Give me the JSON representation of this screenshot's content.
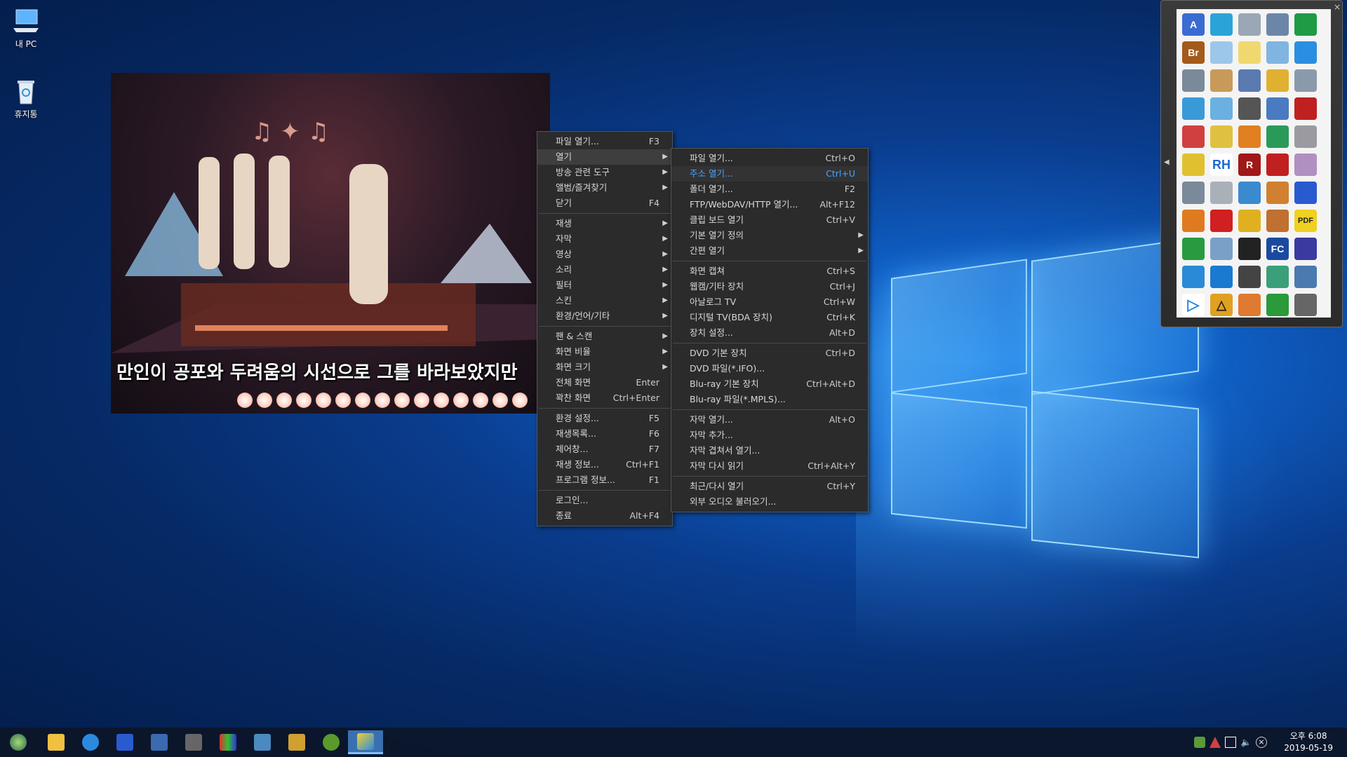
{
  "desktop": {
    "icons": [
      {
        "label": "내 PC",
        "icon": "computer-icon"
      },
      {
        "label": "휴지통",
        "icon": "recycle-bin-icon"
      }
    ]
  },
  "video": {
    "subtitle": "만인이 공포와 두려움의 시선으로 그를 바라보았지만"
  },
  "main_menu": {
    "items": [
      {
        "label": "파일 열기...",
        "shortcut": "F3"
      },
      {
        "label": "열기",
        "submenu": true,
        "highlighted": true
      },
      {
        "label": "방송 관련 도구",
        "submenu": true
      },
      {
        "label": "앨범/즐겨찾기",
        "submenu": true
      },
      {
        "label": "닫기",
        "shortcut": "F4"
      },
      {
        "label": "재생",
        "submenu": true
      },
      {
        "label": "자막",
        "submenu": true
      },
      {
        "label": "영상",
        "submenu": true
      },
      {
        "label": "소리",
        "submenu": true
      },
      {
        "label": "필터",
        "submenu": true
      },
      {
        "label": "스킨",
        "submenu": true
      },
      {
        "label": "환경/언어/기타",
        "submenu": true
      },
      {
        "label": "팬 & 스캔",
        "submenu": true
      },
      {
        "label": "화면 비율",
        "submenu": true
      },
      {
        "label": "화면 크기",
        "submenu": true
      },
      {
        "label": "전체 화면",
        "shortcut": "Enter"
      },
      {
        "label": "꽉찬 화면",
        "shortcut": "Ctrl+Enter"
      },
      {
        "label": "환경 설정...",
        "shortcut": "F5"
      },
      {
        "label": "재생목록...",
        "shortcut": "F6"
      },
      {
        "label": "제어창...",
        "shortcut": "F7"
      },
      {
        "label": "재생 정보...",
        "shortcut": "Ctrl+F1"
      },
      {
        "label": "프로그램 정보...",
        "shortcut": "F1"
      },
      {
        "label": "로그인..."
      },
      {
        "label": "종료",
        "shortcut": "Alt+F4"
      }
    ]
  },
  "open_submenu": {
    "items": [
      {
        "label": "파일 열기...",
        "shortcut": "Ctrl+O"
      },
      {
        "label": "주소 열기...",
        "shortcut": "Ctrl+U",
        "highlighted": true
      },
      {
        "label": "폴더 열기...",
        "shortcut": "F2"
      },
      {
        "label": "FTP/WebDAV/HTTP 열기...",
        "shortcut": "Alt+F12"
      },
      {
        "label": "클립 보드 열기",
        "shortcut": "Ctrl+V"
      },
      {
        "label": "기본 열기 정의",
        "submenu": true
      },
      {
        "label": "간편 열기",
        "submenu": true
      },
      {
        "label": "화면 캡쳐",
        "shortcut": "Ctrl+S"
      },
      {
        "label": "웹캠/기타 장치",
        "shortcut": "Ctrl+J"
      },
      {
        "label": "아날로그 TV",
        "shortcut": "Ctrl+W"
      },
      {
        "label": "디지털 TV(BDA 장치)",
        "shortcut": "Ctrl+K"
      },
      {
        "label": "장치 설정...",
        "shortcut": "Alt+D"
      },
      {
        "label": "DVD 기본 장치",
        "shortcut": "Ctrl+D"
      },
      {
        "label": "DVD 파일(*.IFO)..."
      },
      {
        "label": "Blu-ray 기본 장치",
        "shortcut": "Ctrl+Alt+D"
      },
      {
        "label": "Blu-ray 파일(*.MPLS)..."
      },
      {
        "label": "자막 열기...",
        "shortcut": "Alt+O"
      },
      {
        "label": "자막 추가..."
      },
      {
        "label": "자막 겹쳐서 열기..."
      },
      {
        "label": "자막 다시 읽기",
        "shortcut": "Ctrl+Alt+Y"
      },
      {
        "label": "최근/다시 열기",
        "shortcut": "Ctrl+Y"
      },
      {
        "label": "외부 오디오 불러오기..."
      }
    ]
  },
  "palette": {
    "close_glyph": "×",
    "collapse_glyph": "◀",
    "text_icons": {
      "a": "A",
      "br": "Br",
      "rh": "RH",
      "r": "R",
      "fc": "FC",
      "pdf": "PDF"
    }
  },
  "taskbar": {
    "apps": [
      "start-orb-icon",
      "file-explorer-icon",
      "internet-explorer-icon",
      "floppy-save-icon",
      "grid-app-icon",
      "wolf-app-icon",
      "color-palette-icon",
      "remote-desktop-icon",
      "r-app-icon",
      "bamboo-app-icon",
      "media-player-icon"
    ],
    "clock_time": "오후 6:08",
    "clock_date": "2019-05-19"
  }
}
